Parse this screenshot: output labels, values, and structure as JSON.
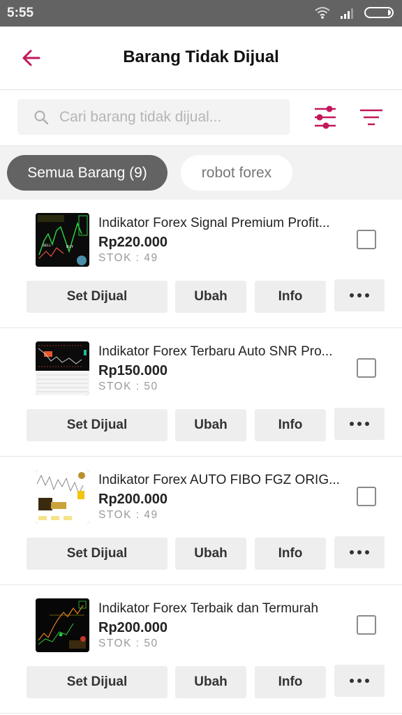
{
  "status_bar": {
    "time": "5:55",
    "icons": [
      "wifi-icon",
      "signal-icon",
      "battery-icon"
    ]
  },
  "app_bar": {
    "back_icon": "arrow-left-icon",
    "title": "Barang Tidak Dijual"
  },
  "search": {
    "placeholder": "Cari barang tidak dijual...",
    "value": "",
    "icon": "search-icon",
    "filter_icon": "sliders-icon",
    "sort_icon": "sort-icon"
  },
  "chips": [
    {
      "label": "Semua Barang (9)",
      "active": true
    },
    {
      "label": "robot forex",
      "active": false
    }
  ],
  "colors": {
    "accent": "#c2185b",
    "status_bar": "#636363",
    "chip_active": "#636363",
    "button_bg": "#eeeeee"
  },
  "products": [
    {
      "name": "Indikator Forex Signal Premium Profit...",
      "price": "Rp220.000",
      "stock": "STOK : 49",
      "checked": false,
      "actions": {
        "set_dijual": "Set Dijual",
        "ubah": "Ubah",
        "info": "Info",
        "more": "more-icon"
      }
    },
    {
      "name": "Indikator Forex Terbaru Auto SNR Pro...",
      "price": "Rp150.000",
      "stock": "STOK : 50",
      "checked": false,
      "actions": {
        "set_dijual": "Set Dijual",
        "ubah": "Ubah",
        "info": "Info",
        "more": "more-icon"
      }
    },
    {
      "name": "Indikator Forex AUTO FIBO FGZ ORIG...",
      "price": "Rp200.000",
      "stock": "STOK : 49",
      "checked": false,
      "actions": {
        "set_dijual": "Set Dijual",
        "ubah": "Ubah",
        "info": "Info",
        "more": "more-icon"
      }
    },
    {
      "name": "Indikator Forex Terbaik dan Termurah",
      "price": "Rp200.000",
      "stock": "STOK : 50",
      "checked": false,
      "actions": {
        "set_dijual": "Set Dijual",
        "ubah": "Ubah",
        "info": "Info",
        "more": "more-icon"
      }
    }
  ]
}
